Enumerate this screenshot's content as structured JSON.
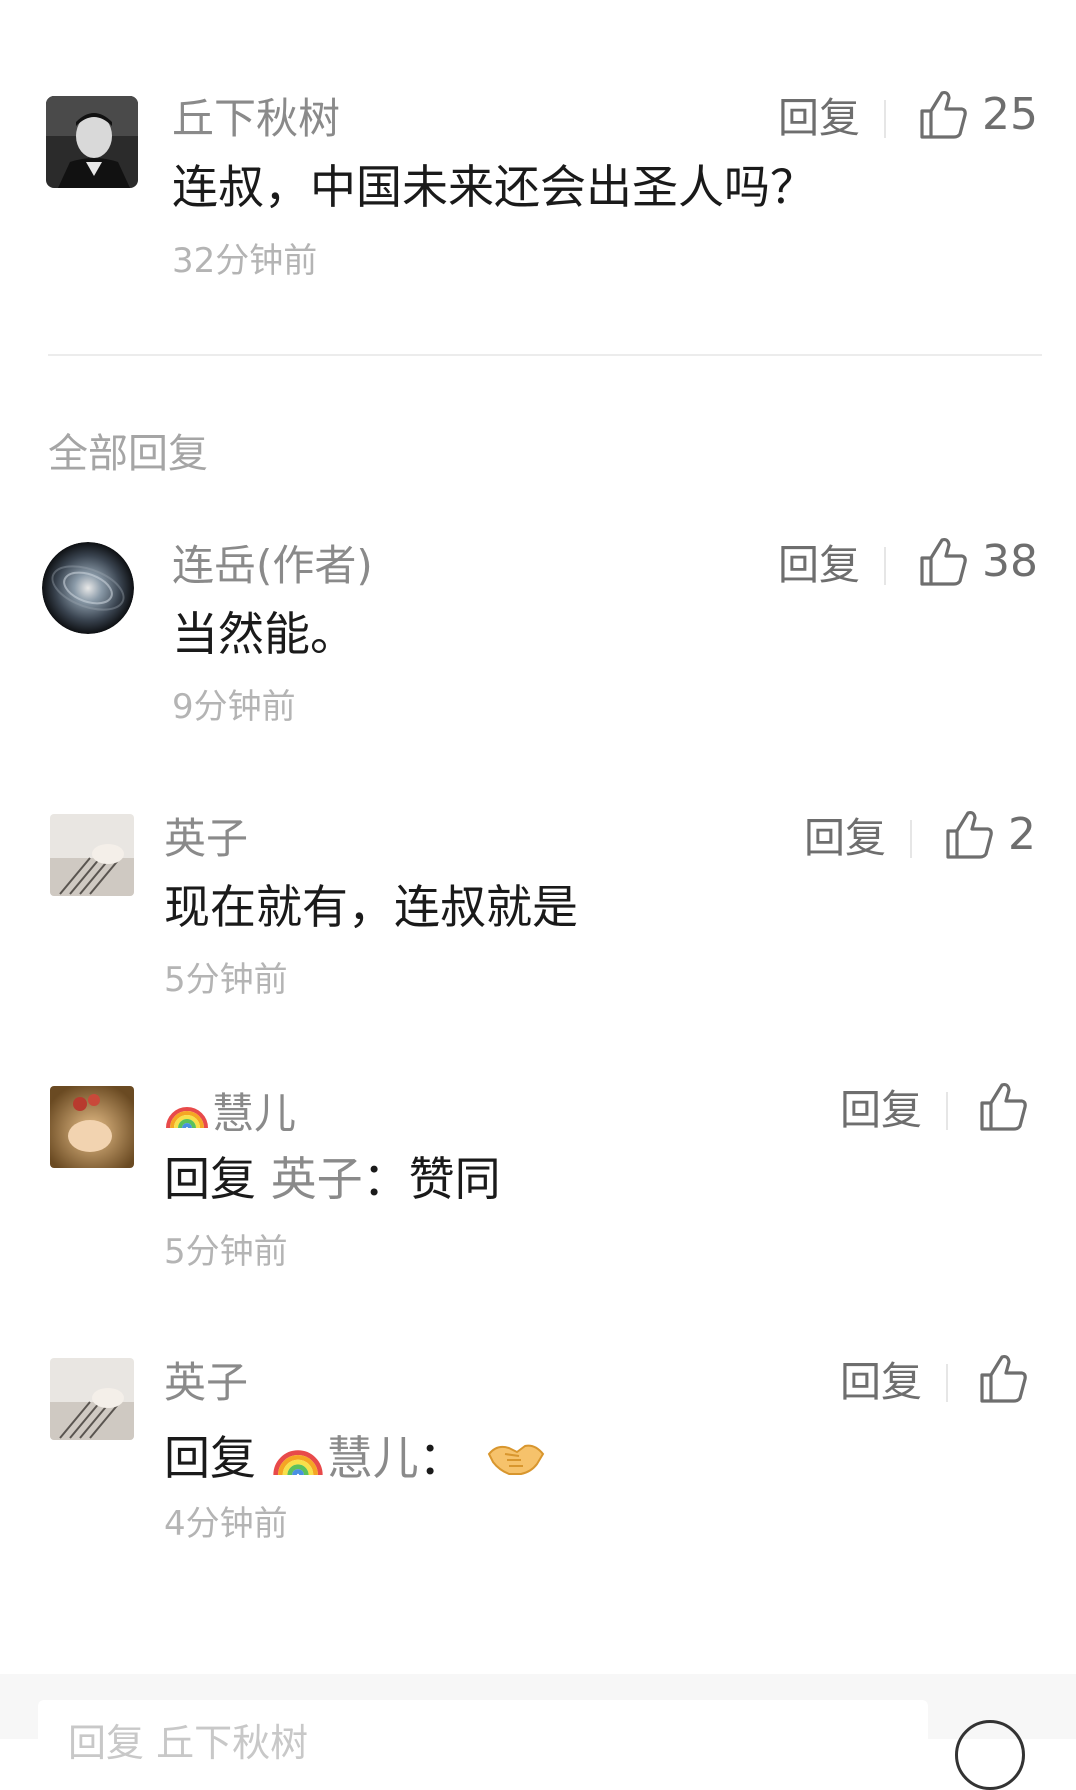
{
  "main_comment": {
    "author": "丘下秋树",
    "text": "连叔，中国未来还会出圣人吗？",
    "time": "32分钟前",
    "reply_label": "回复",
    "likes": "25"
  },
  "section_title": "全部回复",
  "replies": [
    {
      "author": "连岳(作者)",
      "text": "当然能。",
      "time": "9分钟前",
      "reply_label": "回复",
      "likes": "38"
    },
    {
      "author": "英子",
      "text": "现在就有，连叔就是",
      "time": "5分钟前",
      "reply_label": "回复",
      "likes": "2"
    },
    {
      "author": "慧儿",
      "text_prefix": "回复 ",
      "text_target": "英子",
      "text_suffix": "：赞同",
      "time": "5分钟前",
      "reply_label": "回复",
      "likes": ""
    },
    {
      "author": "英子",
      "text_prefix": "回复 ",
      "text_target": "慧儿",
      "text_suffix": "：",
      "time": "4分钟前",
      "reply_label": "回复",
      "likes": ""
    }
  ],
  "bottom_input": {
    "placeholder": "回复 丘下秋树"
  },
  "icons": [
    "thumbs-up-icon",
    "rainbow-icon",
    "handshake-icon"
  ]
}
